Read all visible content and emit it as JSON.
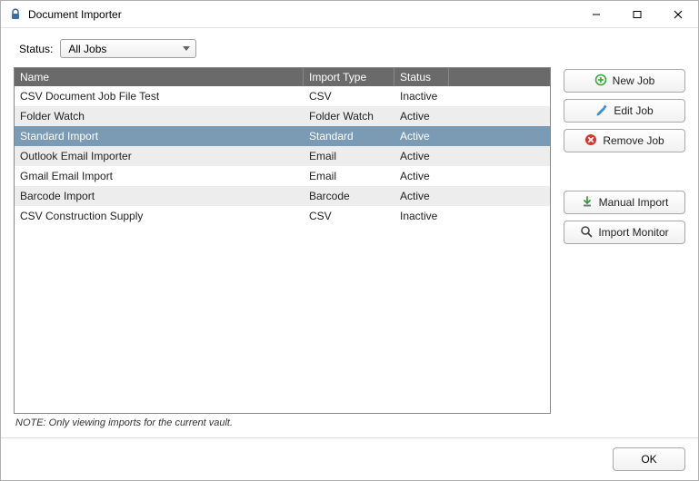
{
  "window": {
    "title": "Document Importer"
  },
  "filter": {
    "label": "Status:",
    "selected": "All Jobs"
  },
  "columns": {
    "name": "Name",
    "type": "Import Type",
    "status": "Status"
  },
  "rows": [
    {
      "name": "CSV Document Job File Test",
      "type": "CSV",
      "status": "Inactive",
      "selected": false
    },
    {
      "name": "Folder Watch",
      "type": "Folder Watch",
      "status": "Active",
      "selected": false
    },
    {
      "name": "Standard Import",
      "type": "Standard",
      "status": "Active",
      "selected": true
    },
    {
      "name": "Outlook Email Importer",
      "type": "Email",
      "status": "Active",
      "selected": false
    },
    {
      "name": "Gmail Email Import",
      "type": "Email",
      "status": "Active",
      "selected": false
    },
    {
      "name": "Barcode Import",
      "type": "Barcode",
      "status": "Active",
      "selected": false
    },
    {
      "name": "CSV Construction Supply",
      "type": "CSV",
      "status": "Inactive",
      "selected": false
    }
  ],
  "note": "NOTE: Only viewing imports for the current vault.",
  "buttons": {
    "new_job": "New Job",
    "edit_job": "Edit Job",
    "remove_job": "Remove Job",
    "manual_import": "Manual Import",
    "import_monitor": "Import Monitor",
    "ok": "OK"
  }
}
